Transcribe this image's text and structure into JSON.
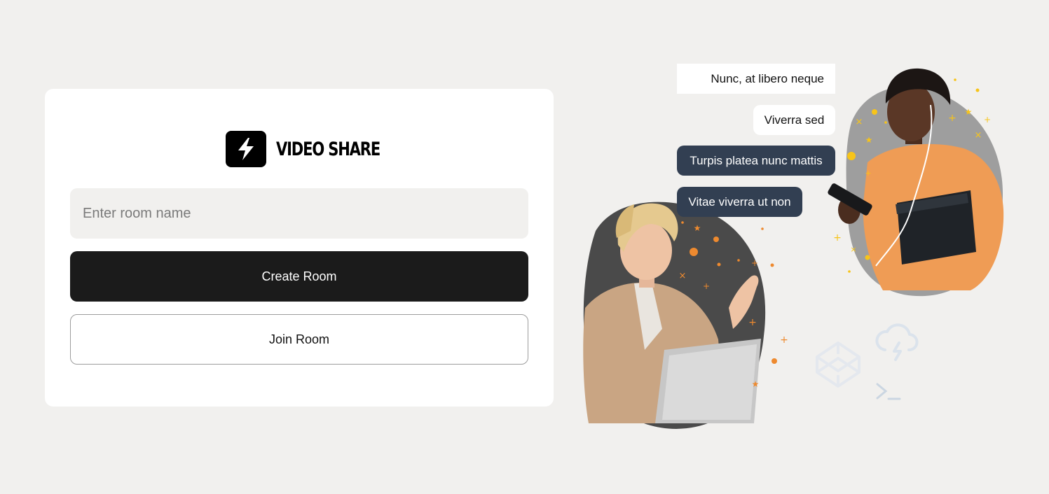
{
  "app": {
    "logo_icon": "lightning-bolt-icon",
    "logo_text": "VIDEO SHARE"
  },
  "form": {
    "room_input_placeholder": "Enter room name",
    "room_input_value": "",
    "create_label": "Create Room",
    "join_label": "Join Room"
  },
  "chat": {
    "messages": [
      "Nunc, at libero neque",
      "Viverra sed",
      "Turpis platea nunc mattis",
      "Vitae viverra ut non"
    ]
  },
  "decor_icons": [
    "codepen-icon",
    "storm-cloud-icon",
    "terminal-icon"
  ],
  "colors": {
    "background": "#f1f0ee",
    "card": "#ffffff",
    "primary_button": "#1b1b1b",
    "chat_dark": "#323f52",
    "accent_orange": "#ee8a2f",
    "accent_yellow": "#f7c419"
  }
}
